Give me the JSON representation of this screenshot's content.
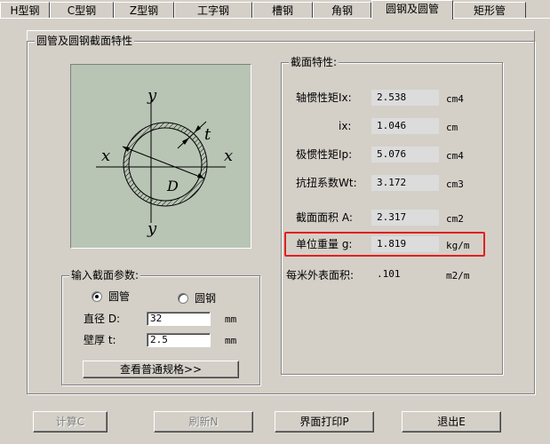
{
  "tabs": [
    {
      "label": "H型钢",
      "active": false
    },
    {
      "label": "C型钢",
      "active": false
    },
    {
      "label": "Z型钢",
      "active": false
    },
    {
      "label": "工字钢",
      "active": false
    },
    {
      "label": "槽钢",
      "active": false
    },
    {
      "label": "角钢",
      "active": false
    },
    {
      "label": "圆钢及圆管",
      "active": true
    },
    {
      "label": "矩形管",
      "active": false
    }
  ],
  "main_group": {
    "title": "圆管及圆钢截面特性"
  },
  "diagram": {
    "labels": {
      "y_top": "y",
      "y_bottom": "y",
      "x_left": "x",
      "x_right": "x",
      "t": "t",
      "D": "D"
    },
    "colors": {
      "background": "#b8c4b4",
      "line": "#000000"
    }
  },
  "props_group": {
    "title": "截面特性:",
    "rows": [
      {
        "label": "轴惯性矩Ix:",
        "value": "2.538",
        "unit": "cm4"
      },
      {
        "label": "ix:",
        "value": "1.046",
        "unit": "cm"
      },
      {
        "label": "极惯性矩Ip:",
        "value": "5.076",
        "unit": "cm4"
      },
      {
        "label": "抗扭系数Wt:",
        "value": "3.172",
        "unit": "cm3"
      },
      {
        "label": "截面面积 A:",
        "value": "2.317",
        "unit": "cm2"
      },
      {
        "label": "单位重量 g:",
        "value": "1.819",
        "unit": "kg/m"
      },
      {
        "label": "每米外表面积:",
        "value": ".101",
        "unit": "m2/m"
      }
    ],
    "highlight_color": "#e02020"
  },
  "input_group": {
    "title": "输入截面参数:",
    "radio_pipe": {
      "label": "圆管",
      "checked": true
    },
    "radio_bar": {
      "label": "圆钢",
      "checked": false
    },
    "diameter": {
      "label": "直径 D:",
      "value": "32",
      "unit": "mm"
    },
    "thickness": {
      "label": "壁厚 t:",
      "value": "2.5",
      "unit": "mm"
    },
    "spec_button": "查看普通规格>>"
  },
  "buttons": {
    "calc": "计算C",
    "refresh": "刷新N",
    "print": "界面打印P",
    "exit": "退出E"
  }
}
